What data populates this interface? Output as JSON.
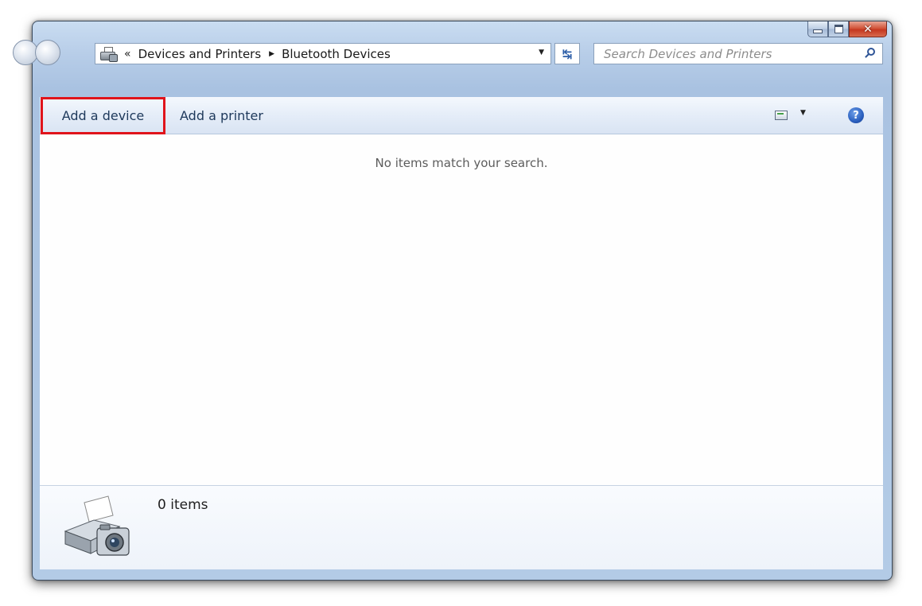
{
  "window": {
    "caption_buttons": {
      "minimize": "minimize-icon",
      "maximize": "maximize-icon",
      "close": "✕"
    }
  },
  "address_bar": {
    "overflow": "«",
    "crumbs": [
      "Devices and Printers",
      "Bluetooth Devices"
    ],
    "separator": "▶",
    "dropdown": "▼"
  },
  "refresh_glyph": "↹",
  "search": {
    "placeholder": "Search Devices and Printers"
  },
  "command_bar": {
    "add_device": "Add a device",
    "add_printer": "Add a printer",
    "view_dropdown": "▼",
    "help": "?",
    "highlight_color": "#e0141b"
  },
  "content": {
    "empty_message": "No items match your search."
  },
  "details": {
    "count": "0 items"
  }
}
